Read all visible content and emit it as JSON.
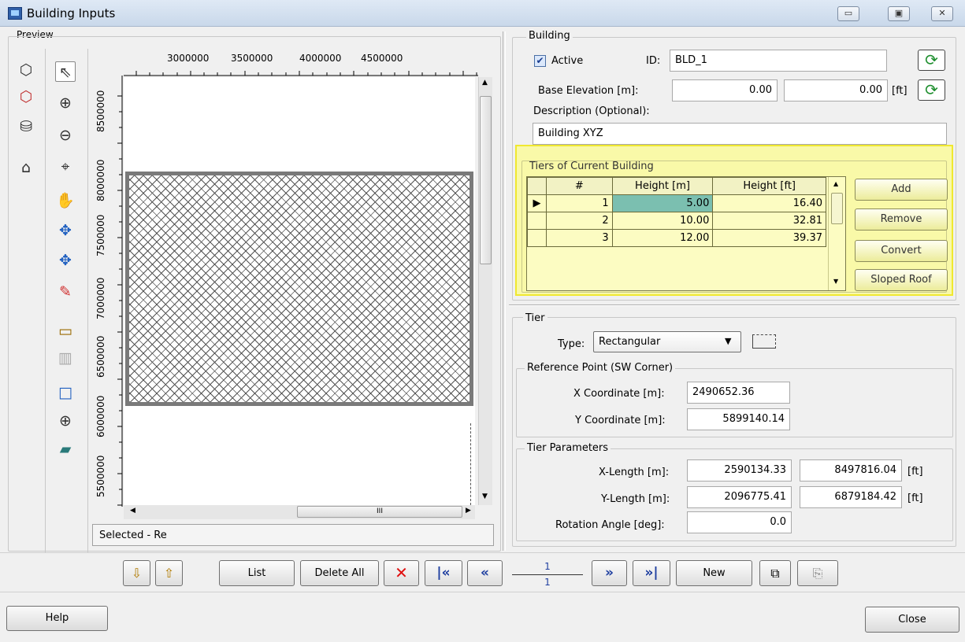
{
  "window": {
    "title": "Building Inputs",
    "minimize": "▭",
    "maximize": "▣",
    "close": "✕"
  },
  "preview": {
    "label": "Preview",
    "x_ticks": [
      "3000000",
      "3500000",
      "4000000",
      "4500000"
    ],
    "y_ticks": [
      "8500000",
      "8000000",
      "7500000",
      "7000000",
      "6500000",
      "6000000",
      "5500000"
    ],
    "status": "Selected - Re",
    "hscroll_grip": "III"
  },
  "building": {
    "label": "Building",
    "active_label": "Active",
    "active_checked": true,
    "id_label": "ID:",
    "id_value": "BLD_1",
    "base_elev_label": "Base Elevation [m]:",
    "base_elev_m": "0.00",
    "base_elev_ft": "0.00",
    "ft_unit": "[ft]",
    "desc_label": "Description (Optional):",
    "desc_value": "Building XYZ"
  },
  "tiers": {
    "label": "Tiers of Current Building",
    "headers": [
      "#",
      "Height [m]",
      "Height [ft]"
    ],
    "rows": [
      {
        "n": "1",
        "m": "5.00",
        "ft": "16.40"
      },
      {
        "n": "2",
        "m": "10.00",
        "ft": "32.81"
      },
      {
        "n": "3",
        "m": "12.00",
        "ft": "39.37"
      }
    ],
    "buttons": {
      "add": "Add",
      "remove": "Remove",
      "convert": "Convert",
      "sloped": "Sloped Roof"
    }
  },
  "tier": {
    "label": "Tier",
    "type_label": "Type:",
    "type_value": "Rectangular",
    "ref_label": "Reference Point (SW Corner)",
    "x_label": "X Coordinate [m]:",
    "x_value": "2490652.36",
    "y_label": "Y Coordinate [m]:",
    "y_value": "5899140.14",
    "params_label": "Tier Parameters",
    "xlen_label": "X-Length [m]:",
    "xlen_m": "2590134.33",
    "xlen_ft": "8497816.04",
    "ylen_label": "Y-Length [m]:",
    "ylen_m": "2096775.41",
    "ylen_ft": "6879184.42",
    "ft_unit": "[ft]",
    "rot_label": "Rotation Angle [deg]:",
    "rot_value": "0.0"
  },
  "nav": {
    "list": "List",
    "delete_all": "Delete All",
    "page_current": "1",
    "page_total": "1",
    "new": "New"
  },
  "footer": {
    "help": "Help",
    "close": "Close"
  },
  "colors": {
    "highlight": "#ffff77",
    "selected_cell": "#7bbfb0"
  }
}
